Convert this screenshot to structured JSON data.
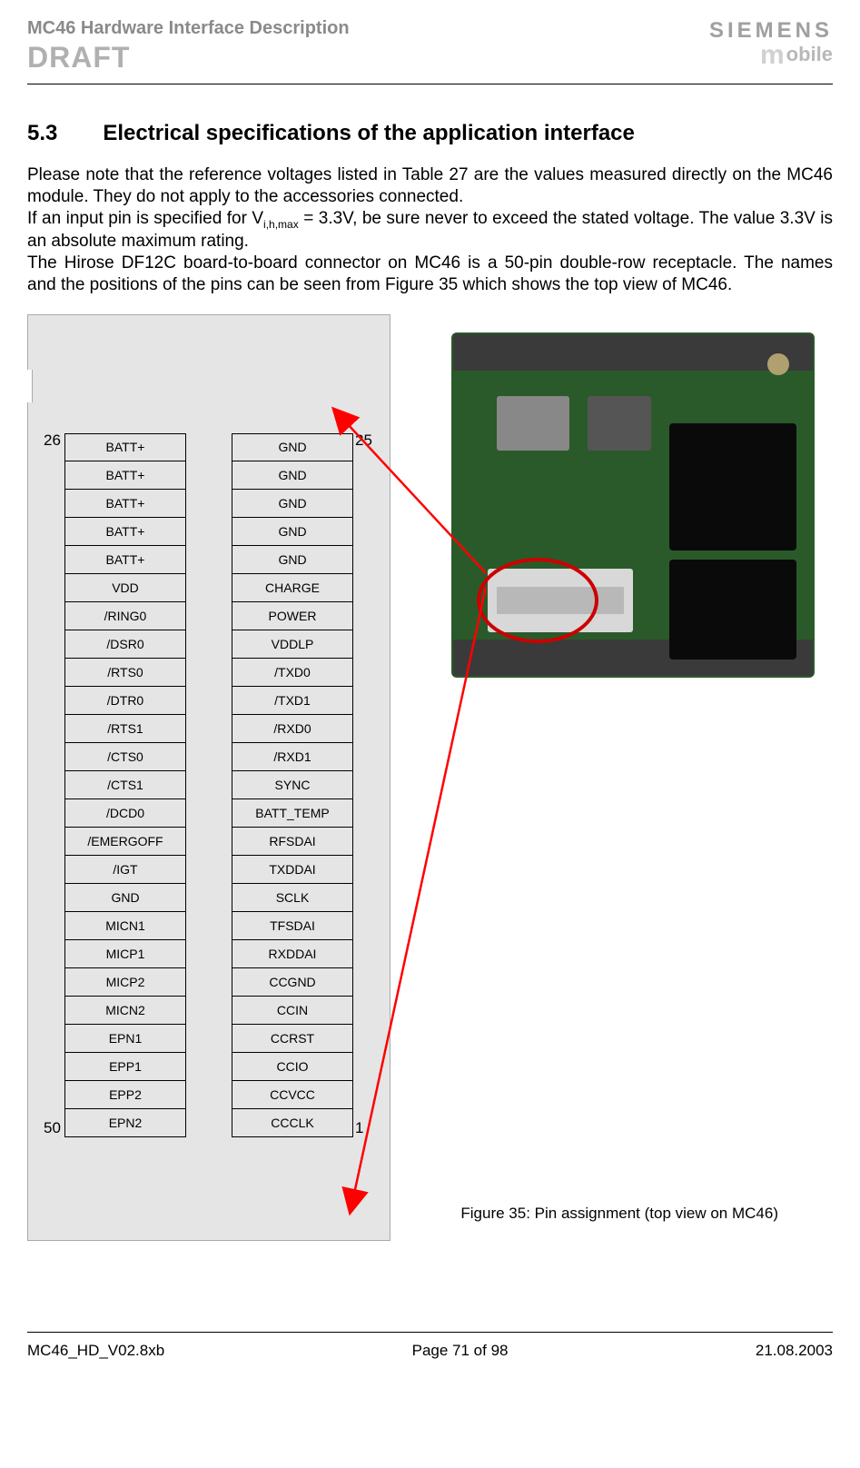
{
  "header": {
    "doc_title": "MC46 Hardware Interface Description",
    "draft": "DRAFT",
    "brand": "SIEMENS",
    "brand_sub": "obile"
  },
  "section": {
    "number": "5.3",
    "title": "Electrical specifications of the application interface"
  },
  "paragraphs": {
    "p1a": "Please note that the reference voltages listed in Table 27 are the values measured directly on the MC46 module. They do not apply to the accessories connected.",
    "p1b_pre": "If an input pin is specified for V",
    "p1b_sub": "i,h,max",
    "p1b_post": " = 3.3V, be sure never to exceed the stated voltage. The value 3.3V is an absolute maximum rating.",
    "p1c": "The Hirose DF12C board-to-board connector on MC46 is a 50-pin double-row receptacle. The names and the positions of the pins can be seen from Figure 35 which shows the top view of MC46."
  },
  "pin_labels": {
    "tl": "26",
    "tr": "25",
    "bl": "50",
    "br": "1"
  },
  "pins_left": [
    "BATT+",
    "BATT+",
    "BATT+",
    "BATT+",
    "BATT+",
    "VDD",
    "/RING0",
    "/DSR0",
    "/RTS0",
    "/DTR0",
    "/RTS1",
    "/CTS0",
    "/CTS1",
    "/DCD0",
    "/EMERGOFF",
    "/IGT",
    "GND",
    "MICN1",
    "MICP1",
    "MICP2",
    "MICN2",
    "EPN1",
    "EPP1",
    "EPP2",
    "EPN2"
  ],
  "pins_right": [
    "GND",
    "GND",
    "GND",
    "GND",
    "GND",
    "CHARGE",
    "POWER",
    "VDDLP",
    "/TXD0",
    "/TXD1",
    "/RXD0",
    "/RXD1",
    "SYNC",
    "BATT_TEMP",
    "RFSDAI",
    "TXDDAI",
    "SCLK",
    "TFSDAI",
    "RXDDAI",
    "CCGND",
    "CCIN",
    "CCRST",
    "CCIO",
    "CCVCC",
    "CCCLK"
  ],
  "figure_caption": "Figure 35: Pin assignment (top view on MC46)",
  "footer": {
    "left": "MC46_HD_V02.8xb",
    "center": "Page 71 of 98",
    "right": "21.08.2003"
  }
}
